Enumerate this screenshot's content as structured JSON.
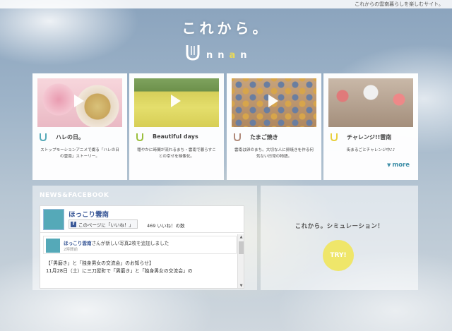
{
  "topbar": {
    "tagline": "これからの雲南暮らしを楽しむサイト。"
  },
  "header": {
    "title": "これから。",
    "logo_letters": "nn",
    "logo_accent": "a",
    "logo_tail": "n"
  },
  "cards": [
    {
      "title": "ハレの日。",
      "desc": "ストップモーションアニメで綴る「ハレの日の雲南」ストーリー。",
      "icon_color": "#55a9b8"
    },
    {
      "title": "Beautiful days",
      "desc": "穏やかに時間が流れるまち・雲南で暮らすことの幸せを映像化。",
      "icon_color": "#9bbf3c"
    },
    {
      "title": "たまご焼き",
      "desc": "雲南は卵のまち。大切な人に卵焼きを作る何気ない日常の物語。",
      "icon_color": "#b08a7a"
    },
    {
      "title": "チャレンジ!!雲南",
      "desc": "街まるごとチャレンジ中♪♪",
      "icon_color": "#e8cf3c",
      "more": "more"
    }
  ],
  "news": {
    "heading": "NEWS&FACEBOOK",
    "fb": {
      "page_name": "ほっこり雲南",
      "like_button": "このページに「いいね！」",
      "like_count": "469 いいね！の数",
      "post_author": "ほっこり雲南",
      "post_action": "さんが新しい写真2枚を追加しました",
      "post_time": "2時間前",
      "body_line1": "【「男磨き」と「独身男女の交流会」のお知らせ】",
      "body_line2": "11月28日（土）に三刀屋町で「男磨き」と「独身男女の交流会」の"
    }
  },
  "sim": {
    "title": "これから。シミュレーション！",
    "button": "TRY!"
  },
  "colors": {
    "accent": "#e8d95a",
    "link": "#3f8fa8",
    "fb_blue": "#3b5998"
  }
}
